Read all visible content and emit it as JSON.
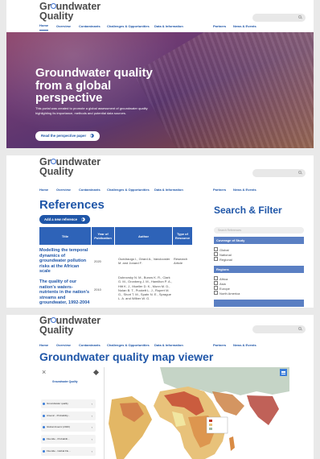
{
  "logo": {
    "line1": "Gr",
    "line1_end": "undwater",
    "line2": "Quality"
  },
  "nav": [
    "Home",
    "Overview",
    "Contaminants",
    "Challenges & Opportunities",
    "Data & Information",
    "Partners",
    "News & Events"
  ],
  "hero": {
    "title": "Groundwater quality from a global perspective",
    "desc": "This portal was created to promote a global assessment of groundwater quality highlighting its importance, methods and potential data sources.",
    "button": "Read the perspective paper"
  },
  "references": {
    "title": "References",
    "add_button": "Add a new reference",
    "columns": [
      "Title",
      "Year of Publication",
      "Author",
      "Type of Resource"
    ],
    "rows": [
      {
        "title": "Modelling the temporal dynamics of groundwater pollution risks at the African scale",
        "year": "2020",
        "author": "Ouedraogo I., Girard A., Vanclooster M. and Jonard F.",
        "type": "Research Article"
      },
      {
        "title": "The quality of our nation's waters-nutrients in the nation's streams and groundwater, 1992-2004",
        "year": "2010",
        "author": "Dubrovsky N. M., Burow K. R., Clark G. M., Gronberg J. M., Hamilton P. A., Hitt K. J., Mueller D. K., Munn M. D., Nolan B. T., Puckett L. J., Rupert M. G., Short T. M., Spahr N. E., Sprague L. A. and Wilber W. G.",
        "type": ""
      }
    ]
  },
  "filter": {
    "title": "Search & Filter",
    "placeholder": "Search References",
    "coverage_label": "Coverage of Study",
    "coverage": [
      "Global",
      "National",
      "Regional"
    ],
    "regions_label": "Regions",
    "regions": [
      "Africa",
      "Asia",
      "Europe",
      "North America"
    ]
  },
  "map_viewer": {
    "title": "Groundwater quality map viewer",
    "panel_title": "Groundwater Quality",
    "layers": [
      "Groundwater quality",
      "Arsenic - Probability...",
      "Global Arsenic (2020)",
      "Fluoride - Probabilit...",
      "Fluoride - Global Flu..."
    ]
  },
  "colors": {
    "brand": "#1f56a8",
    "accent": "#3b7dd8"
  }
}
